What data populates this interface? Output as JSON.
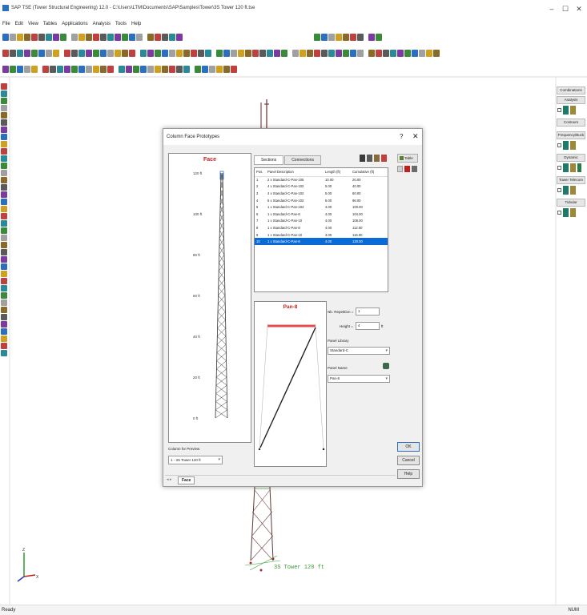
{
  "window": {
    "title": "SAP TSE (Tower Structural Engineering) 12.0 - C:\\Users\\LTM\\Documents\\SAP\\Samples\\Tower\\3S Tower 120 ft.tse",
    "minimize": "–",
    "maximize": "☐",
    "close": "✕"
  },
  "menu": [
    "File",
    "Edit",
    "View",
    "Tables",
    "Applications",
    "Analysis",
    "Tools",
    "Help"
  ],
  "status": {
    "left": "Ready",
    "right": "NUM"
  },
  "right_panel": {
    "buttons": [
      "Combinations",
      "Analysis",
      "Contours",
      "Frequency/Buck",
      "Dynamic",
      "Tower Telecom",
      "Tubular"
    ]
  },
  "canvas": {
    "tower_label": "3S Tower 120 ft",
    "axis_x": "X",
    "axis_z": "Z"
  },
  "dialog": {
    "title": "Column Face Prototypes",
    "help": "?",
    "close": "✕",
    "face_header": "Face",
    "elevations": [
      "120 ft",
      "100 ft",
      "80 ft",
      "60 ft",
      "40 ft",
      "20 ft",
      "0 ft"
    ],
    "tabs": [
      "Sections",
      "Connections"
    ],
    "table_button": "Table",
    "columns": [
      "Pos.",
      "Panel Description",
      "Length (ft)",
      "Cumulative (ft)"
    ],
    "rows": [
      [
        "1",
        "2 x Standard-C-Pan-105",
        "10.00",
        "20.00"
      ],
      [
        "2",
        "4 x Standard-C-Pan-102",
        "5.00",
        "40.00"
      ],
      [
        "3",
        "4 x Standard-C-Pan-102",
        "5.00",
        "60.00"
      ],
      [
        "4",
        "6 x Standard-C-Pan-102",
        "6.00",
        "96.00"
      ],
      [
        "5",
        "1 x Standard-C-Pan-104",
        "4.00",
        "100.00"
      ],
      [
        "6",
        "1 x Standard-C-Pan-8",
        "4.00",
        "104.00"
      ],
      [
        "7",
        "1 x Standard-C-Pan-10",
        "4.00",
        "108.00"
      ],
      [
        "8",
        "1 x Standard-C-Pan-8",
        "4.00",
        "112.00"
      ],
      [
        "9",
        "1 x Standard-C-Pan-10",
        "4.00",
        "116.00"
      ],
      [
        "10",
        "1 x Standard-C-Pan-8",
        "4.00",
        "120.00"
      ]
    ],
    "selected_row": 9,
    "panel_header": "Pan-8",
    "repetition_label": "Nb. Repetition =",
    "repetition_value": "1",
    "height_label": "Height =",
    "height_value": "4",
    "height_unit": "ft",
    "panel_library_label": "Panel Library",
    "panel_library_value": "Standard-C",
    "panel_name_label": "Panel Name",
    "panel_name_value": "Pan-8",
    "ok": "OK",
    "cancel": "Cancel",
    "help_btn": "Help",
    "preview_label": "Column for Preview",
    "preview_value": "1 - 3S Tower 120 ft",
    "bottom_tab": "Face",
    "tab_arrows": "◂ ▸"
  }
}
